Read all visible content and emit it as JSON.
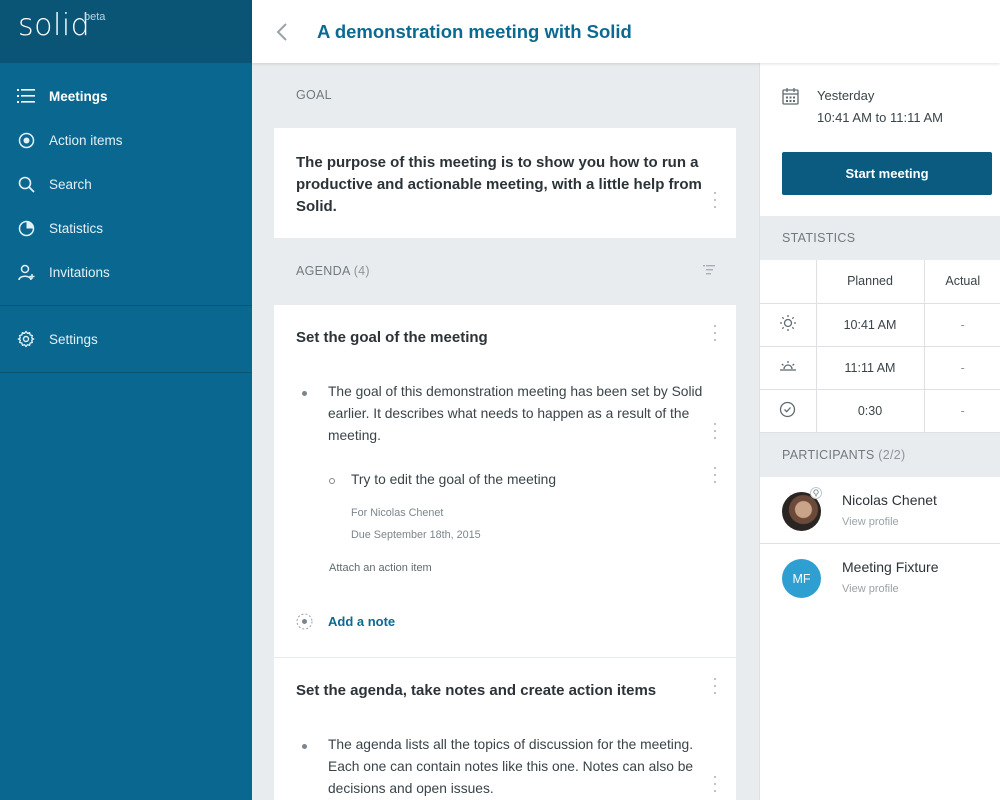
{
  "brand": {
    "logo": "solid",
    "tag": "beta"
  },
  "sidebar": {
    "items": [
      {
        "label": "Meetings",
        "icon": "list-icon"
      },
      {
        "label": "Action items",
        "icon": "target-icon"
      },
      {
        "label": "Search",
        "icon": "search-icon"
      },
      {
        "label": "Statistics",
        "icon": "pie-chart-icon"
      },
      {
        "label": "Invitations",
        "icon": "add-user-icon"
      }
    ],
    "settings": {
      "label": "Settings",
      "icon": "gear-icon"
    }
  },
  "header": {
    "title": "A demonstration meeting with Solid"
  },
  "goal": {
    "label": "GOAL",
    "text": "The purpose of this meeting is to show you how to run a productive and actionable meeting, with a little help from Solid."
  },
  "agenda": {
    "label": "AGENDA",
    "count": "(4)",
    "items": [
      {
        "title": "Set the goal of the meeting",
        "note": "The goal of this demonstration meeting has been set by Solid earlier. It describes what needs to happen as a result of the meeting.",
        "action": {
          "text": "Try to edit the goal of the meeting",
          "assignee": "For Nicolas Chenet",
          "due": "Due September 18th, 2015"
        },
        "attach_label": "Attach an action item",
        "add_note_label": "Add a note"
      },
      {
        "title": "Set the agenda, take notes and create action items",
        "note": "The agenda lists all the topics of discussion for the meeting. Each one can contain notes like this one. Notes can also be decisions and open issues."
      }
    ]
  },
  "schedule": {
    "day": "Yesterday",
    "time": "10:41 AM to 11:11 AM"
  },
  "start_button": "Start meeting",
  "statistics": {
    "label": "STATISTICS",
    "columns": [
      "Planned",
      "Actual"
    ],
    "rows": [
      {
        "icon": "sunrise-icon",
        "planned": "10:41 AM",
        "actual": "-"
      },
      {
        "icon": "sunset-icon",
        "planned": "11:11 AM",
        "actual": "-"
      },
      {
        "icon": "clock-icon",
        "planned": "0:30",
        "actual": "-"
      }
    ]
  },
  "participants": {
    "label": "PARTICIPANTS",
    "count": "(2/2)",
    "list": [
      {
        "name": "Nicolas Chenet",
        "link": "View profile"
      },
      {
        "name": "Meeting Fixture",
        "initials": "MF",
        "link": "View profile"
      }
    ]
  },
  "colors": {
    "sidebar": "#0a6890",
    "brand_bar": "#0a5576",
    "accent": "#0b6a92",
    "avatar_mf": "#2e9fd0"
  }
}
